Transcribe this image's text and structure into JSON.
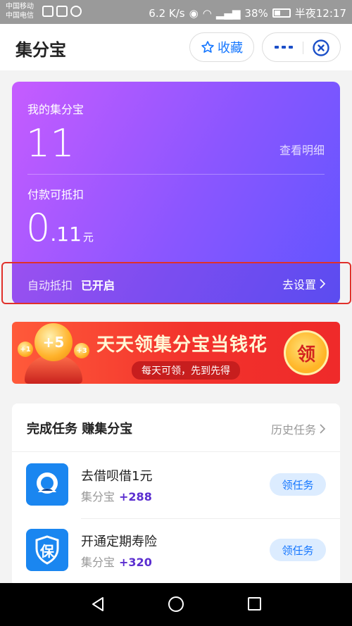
{
  "status_bar": {
    "carrier1": "中国移动",
    "carrier2": "中国电信",
    "speed": "6.2 K/s",
    "battery": "38%",
    "time": "半夜12:17"
  },
  "header": {
    "title": "集分宝",
    "favorite_label": "收藏"
  },
  "balance_card": {
    "label": "我的集分宝",
    "points": "11",
    "detail_link": "查看明细",
    "deduct_label": "付款可抵扣",
    "amount_int": "0",
    "amount_dec": ".11",
    "amount_unit": "元",
    "auto_deduct_label": "自动抵扣",
    "auto_deduct_status": "已开启",
    "settings_link": "去设置"
  },
  "banner": {
    "coin": "+5",
    "coin_small_1": "+1",
    "coin_small_2": "+3",
    "title": "天天领集分宝当钱花",
    "subtitle": "每天可领，先到先得",
    "button": "领"
  },
  "tasks": {
    "title": "完成任务 赚集分宝",
    "history": "历史任务",
    "items": [
      {
        "name": "去借呗借1元",
        "unit": "集分宝",
        "points": "+288",
        "button": "领任务",
        "icon": "jiebei-icon"
      },
      {
        "name": "开通定期寿险",
        "unit": "集分宝",
        "points": "+320",
        "button": "领任务",
        "icon": "insurance-shield-icon",
        "icon_text": "保"
      }
    ]
  },
  "colors": {
    "card_gradient_start": "#c65cff",
    "card_gradient_end": "#5f55ff",
    "accent_blue": "#1677ff",
    "points_purple": "#5b2ed0",
    "banner_red": "#f2322c",
    "highlight_red": "#e0302a"
  }
}
